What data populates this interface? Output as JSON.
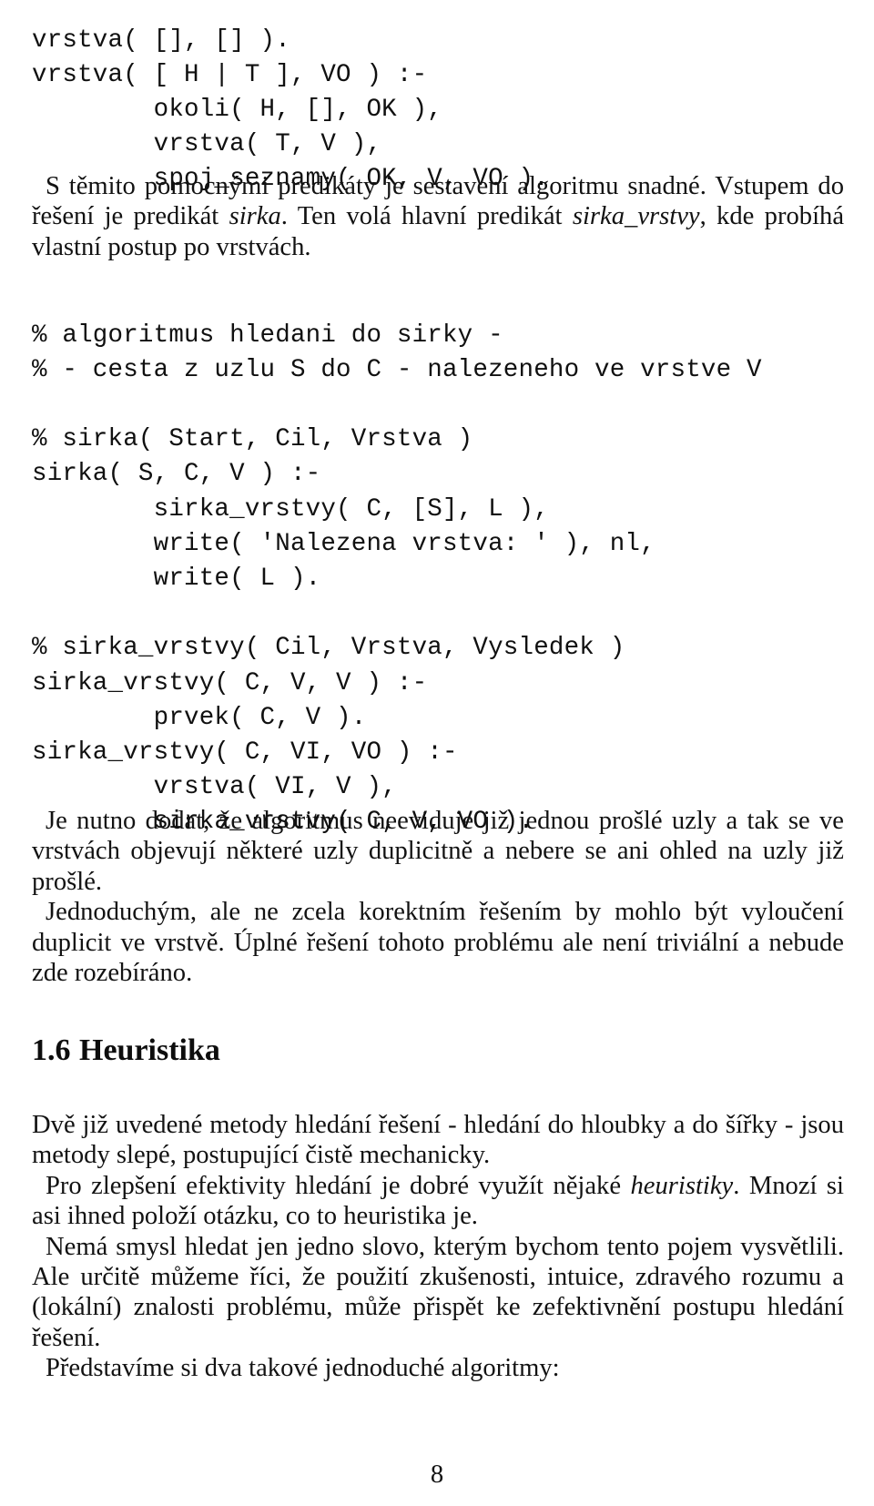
{
  "document": {
    "language": "cs",
    "page_number": "8"
  },
  "code_top": {
    "lines": [
      "vrstva( [], [] ).",
      "vrstva( [ H | T ], VO ) :-",
      "        okoli( H, [], OK ),",
      "        vrstva( T, V ),",
      "        spoj_seznamy( OK, V, VO )."
    ]
  },
  "prose_intro": {
    "paragraphs": [
      {
        "indent": true,
        "runs": [
          {
            "style": "normal",
            "text": "S těmito pomocnými predikáty je sestavení algoritmu snadné. Vstupem do řešení je predikát "
          },
          {
            "style": "italic",
            "text": "sirka"
          },
          {
            "style": "normal",
            "text": ". Ten volá hlavní predikát "
          },
          {
            "style": "italic",
            "text": "sirka_vrstvy"
          },
          {
            "style": "normal",
            "text": ", kde probíhá vlastní postup po vrstvách."
          }
        ]
      }
    ]
  },
  "code_middle": {
    "lines": [
      "% algoritmus hledani do sirky -",
      "% - cesta z uzlu S do C - nalezeneho ve vrstve V",
      "",
      "% sirka( Start, Cil, Vrstva )",
      "sirka( S, C, V ) :-",
      "        sirka_vrstvy( C, [S], L ),",
      "        write( 'Nalezena vrstva: ' ), nl,",
      "        write( L ).",
      "",
      "% sirka_vrstvy( Cil, Vrstva, Vysledek )",
      "sirka_vrstvy( C, V, V ) :-",
      "        prvek( C, V ).",
      "sirka_vrstvy( C, VI, VO ) :-",
      "        vrstva( VI, V ),",
      "        sirka_vrstvy( C, V, VO )."
    ]
  },
  "prose_mid": {
    "paragraphs": [
      {
        "indent": true,
        "runs": [
          {
            "style": "normal",
            "text": "Je nutno dodat, že algoritmus neeviduje již jednou prošlé uzly a tak se ve vrstvách objevují některé uzly duplicitně a nebere se ani ohled na uzly již prošlé."
          }
        ]
      },
      {
        "indent": true,
        "runs": [
          {
            "style": "normal",
            "text": "Jednoduchým, ale ne zcela korektním řešením by mohlo být vyloučení duplicit ve vrstvě. Úplné řešení tohoto problému ale není triviální a nebude zde rozebíráno."
          }
        ]
      }
    ]
  },
  "section_heading": {
    "number": "1.6",
    "title": "Heuristika"
  },
  "prose_tail": {
    "paragraphs": [
      {
        "indent": false,
        "runs": [
          {
            "style": "normal",
            "text": "Dvě již uvedené metody hledání řešení - hledání do hloubky a do šířky - jsou metody slepé, postupující čistě mechanicky."
          }
        ]
      },
      {
        "indent": true,
        "runs": [
          {
            "style": "normal",
            "text": "Pro zlepšení efektivity hledání je dobré využít nějaké "
          },
          {
            "style": "italic",
            "text": "heuristiky"
          },
          {
            "style": "normal",
            "text": ". Mnozí si asi ihned položí otázku, co to heuristika je."
          }
        ]
      },
      {
        "indent": true,
        "runs": [
          {
            "style": "normal",
            "text": "Nemá smysl hledat jen jedno slovo, kterým bychom tento pojem vysvětlili. Ale určitě můžeme říci, že použití zkušenosti, intuice, zdravého rozumu a (lokální) znalosti problému, může přispět ke zefektivnění postupu hledání řešení."
          }
        ]
      },
      {
        "indent": true,
        "runs": [
          {
            "style": "normal",
            "text": "Představíme si dva takové jednoduché algoritmy:"
          }
        ]
      }
    ]
  }
}
